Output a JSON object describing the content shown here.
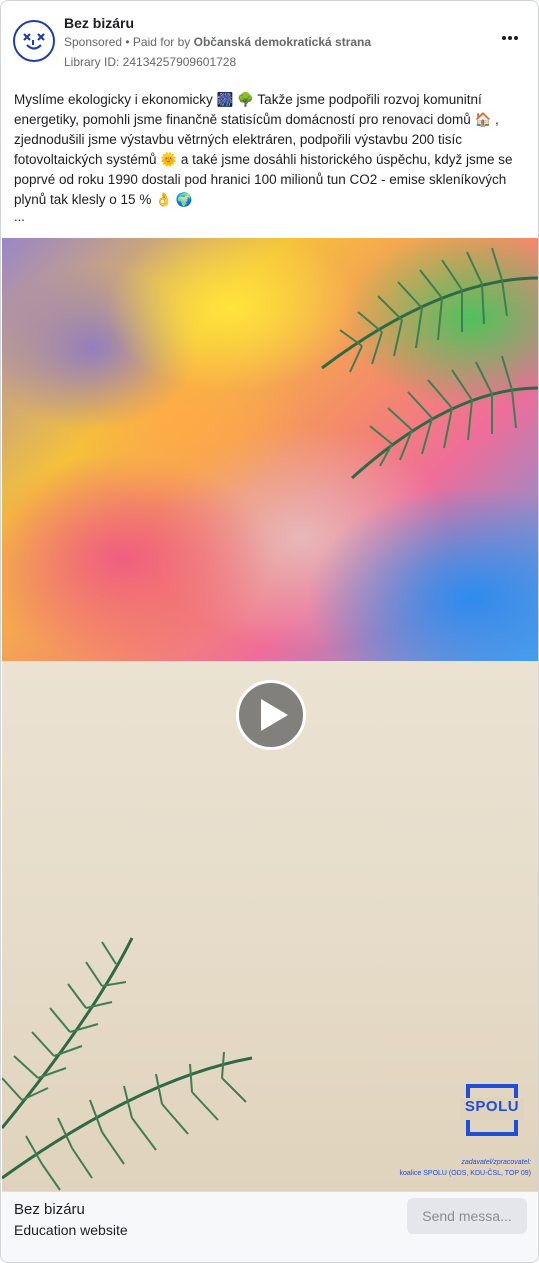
{
  "post": {
    "page_name": "Bez bizáru",
    "sponsored_label": "Sponsored",
    "paid_for_prefix": " • Paid for by ",
    "paid_for_by": "Občanská demokratická strana",
    "library_id": "Library ID: 24134257909601728",
    "more_icon": "more-horizontal-icon",
    "body": "Myslíme ekologicky i ekonomicky 🎆 🌳 Takže jsme podpořili rozvoj komunitní energetiky, pomohli jsme finančně statisícům domácností pro renovaci domů 🏠 , zjednodušili jsme výstavbu větrných elektráren, podpořili výstavbu 200 tisíc fotovoltaických systémů 🌞 a také jsme dosáhli historického úspěchu, když jsme se poprvé od roku 1990 dostali pod hranici 100 milionů tun CO2 - emise skleníkových plynů tak klesly o 15 % 👌 🌍",
    "ellipsis": "..."
  },
  "media": {
    "type": "video",
    "play_icon": "play-icon",
    "logo_text": "SPOLU",
    "credit_line_1": "zadavatel/zpracovatel:",
    "credit_line_2": "koalice SPOLU (ODS, KDU-ČSL, TOP 09)"
  },
  "footer": {
    "title": "Bez bizáru",
    "subtitle": "Education website",
    "cta_label": "Send messa..."
  },
  "colors": {
    "brand_blue": "#1f4fd8",
    "text": "#1c1e21",
    "muted": "#65676b"
  }
}
